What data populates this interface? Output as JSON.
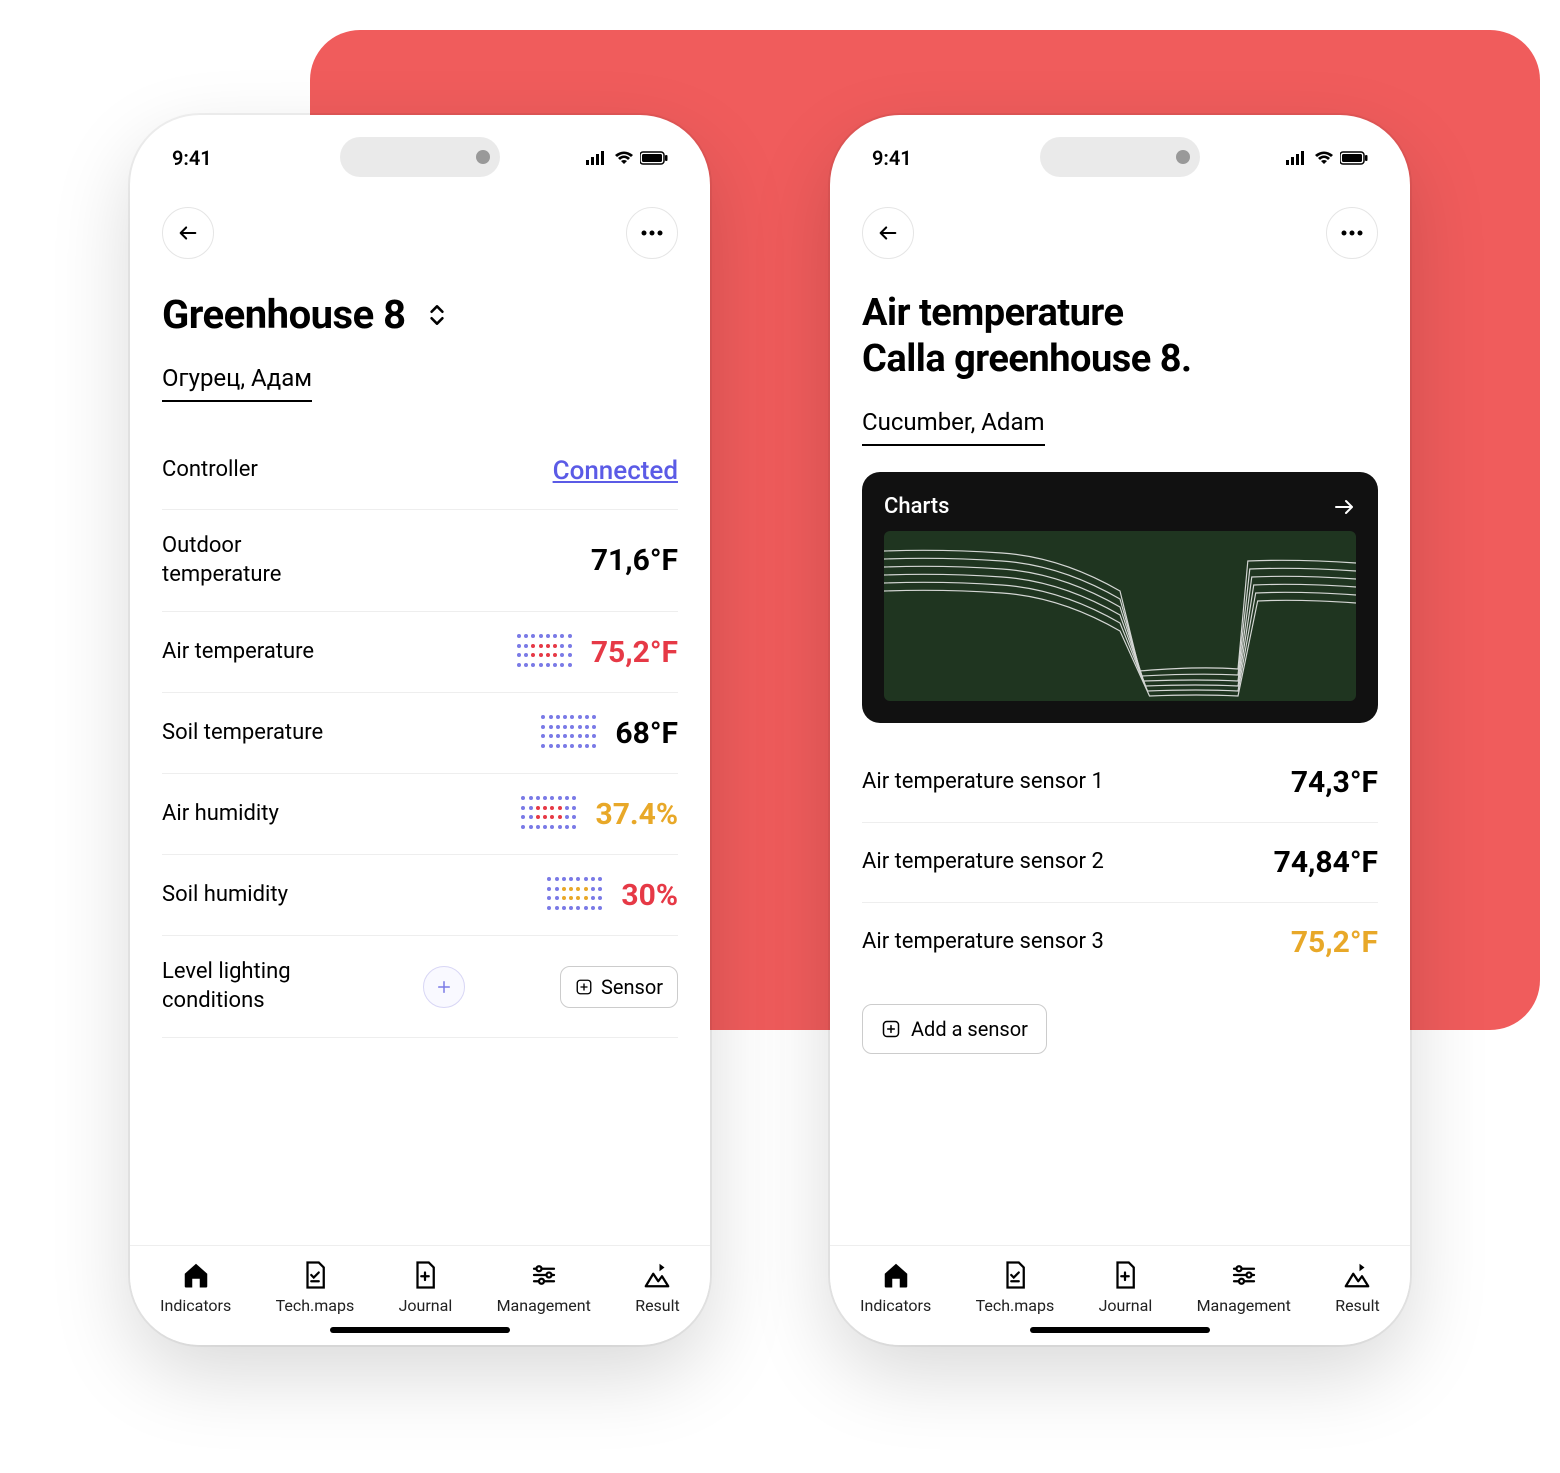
{
  "statusbar": {
    "time": "9:41"
  },
  "phone1": {
    "title": "Greenhouse 8",
    "subtitle": "Огурец, Адам",
    "rows": {
      "controller": {
        "label": "Controller",
        "status": "Connected"
      },
      "outdoor": {
        "label": "Outdoor temperature",
        "value": "71,6°F"
      },
      "airtemp": {
        "label": "Air temperature",
        "value": "75,2°F"
      },
      "soiltemp": {
        "label": "Soil temperature",
        "value": "68°F"
      },
      "airhum": {
        "label": "Air humidity",
        "value": "37.4%"
      },
      "soilhum": {
        "label": "Soil humidity",
        "value": "30%"
      },
      "lighting": {
        "label": "Level lighting conditions"
      }
    },
    "sensor_btn": "Sensor"
  },
  "phone2": {
    "title_line1": "Air temperature",
    "title_line2": "Calla greenhouse 8.",
    "subtitle": "Cucumber, Adam",
    "charts_label": "Charts",
    "sensors": [
      {
        "label": "Air temperature sensor 1",
        "value": "74,3°F"
      },
      {
        "label": "Air temperature sensor 2",
        "value": "74,84°F"
      },
      {
        "label": "Air temperature sensor 3",
        "value": "75,2°F"
      }
    ],
    "add_sensor": "Add a sensor"
  },
  "tabs": {
    "indicators": "Indicators",
    "techmaps": "Tech.maps",
    "journal": "Journal",
    "management": "Management",
    "result": "Result"
  }
}
